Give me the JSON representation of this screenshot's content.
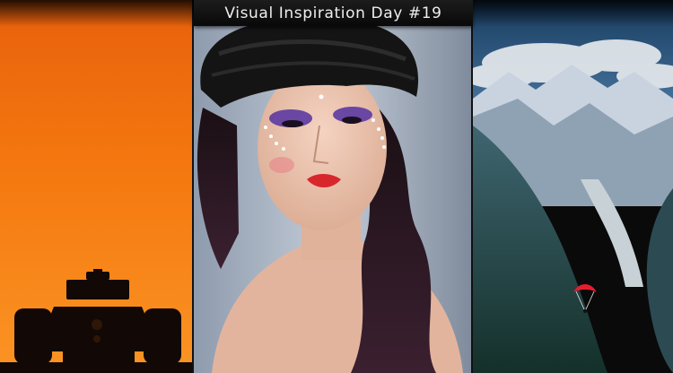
{
  "header": {
    "title": "Visual Inspiration Day #19"
  },
  "panels": [
    {
      "subject": "race-car-silhouette",
      "accent": "#f57b12"
    },
    {
      "subject": "portrait-woman-black-turban",
      "accent": "#5a3f8f"
    },
    {
      "subject": "mountain-valley-paraglider",
      "accent": "#2f4b57"
    }
  ],
  "colors": {
    "sunset_top": "#f26f10",
    "sunset_bottom": "#fb8f20",
    "backdrop": "#a9b4c3",
    "turban": "#141414",
    "lipstick": "#d8262d",
    "eyeshadow": "#5b3aa2",
    "glider": "#e51e2d"
  }
}
